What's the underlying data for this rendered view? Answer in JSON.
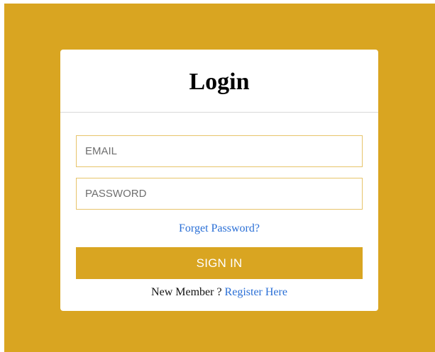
{
  "login_form": {
    "title": "Login",
    "email_placeholder": "EMAIL",
    "email_value": "",
    "password_placeholder": "PASSWORD",
    "password_value": "",
    "forgot_password_label": "Forget Password?",
    "submit_label": "SIGN IN",
    "register_prompt": "New Member ?",
    "register_link_label": "Register Here"
  },
  "colors": {
    "background": "#d9a521",
    "card": "#ffffff",
    "button": "#d9a521",
    "link": "#2a6fd6",
    "field_border": "#e7c46a"
  }
}
